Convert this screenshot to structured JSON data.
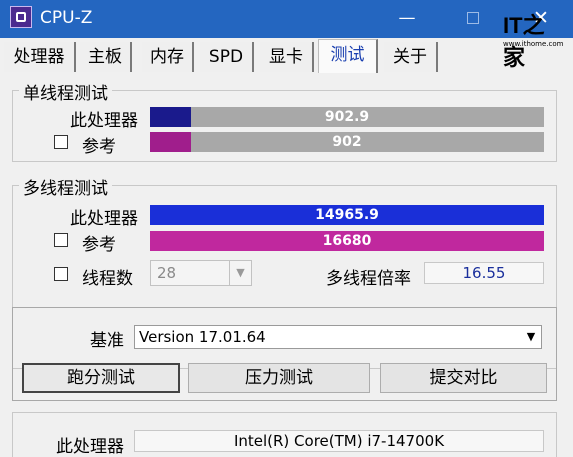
{
  "window": {
    "title": "CPU-Z",
    "minimize_glyph": "—",
    "close_glyph": "✕"
  },
  "watermark": {
    "logo": "IT之家",
    "url": "www.ithome.com"
  },
  "tabs": [
    {
      "label": "处理器",
      "active": false
    },
    {
      "label": "主板",
      "active": false
    },
    {
      "label": "内存",
      "active": false
    },
    {
      "label": "SPD",
      "active": false
    },
    {
      "label": "显卡",
      "active": false
    },
    {
      "label": "测试",
      "active": true
    },
    {
      "label": "关于",
      "active": false
    }
  ],
  "single_thread": {
    "title": "单线程测试",
    "this_cpu": {
      "label": "此处理器",
      "value": "902.9",
      "fill_fraction": 0.105,
      "fill_color": "#1a1a8c"
    },
    "reference": {
      "label": "参考",
      "value": "902",
      "fill_fraction": 0.105,
      "fill_color": "#a01e8c",
      "checked": false
    },
    "track_color": "#a8a8a8"
  },
  "multi_thread": {
    "title": "多线程测试",
    "this_cpu": {
      "label": "此处理器",
      "value": "14965.9",
      "fill_fraction": 1.0,
      "fill_color": "#1a2fd8"
    },
    "reference": {
      "label": "参考",
      "value": "16680",
      "fill_fraction": 1.0,
      "fill_color": "#c0289e",
      "checked": false
    },
    "threads": {
      "label": "线程数",
      "value": "28",
      "checked": false
    },
    "ratio": {
      "label": "多线程倍率",
      "value": "16.55"
    }
  },
  "baseline": {
    "label": "基准",
    "value": "Version 17.01.64"
  },
  "buttons": {
    "bench": "跑分测试",
    "stress": "压力测试",
    "submit": "提交对比"
  },
  "footer": {
    "label": "此处理器",
    "value": "Intel(R) Core(TM) i7-14700K"
  }
}
